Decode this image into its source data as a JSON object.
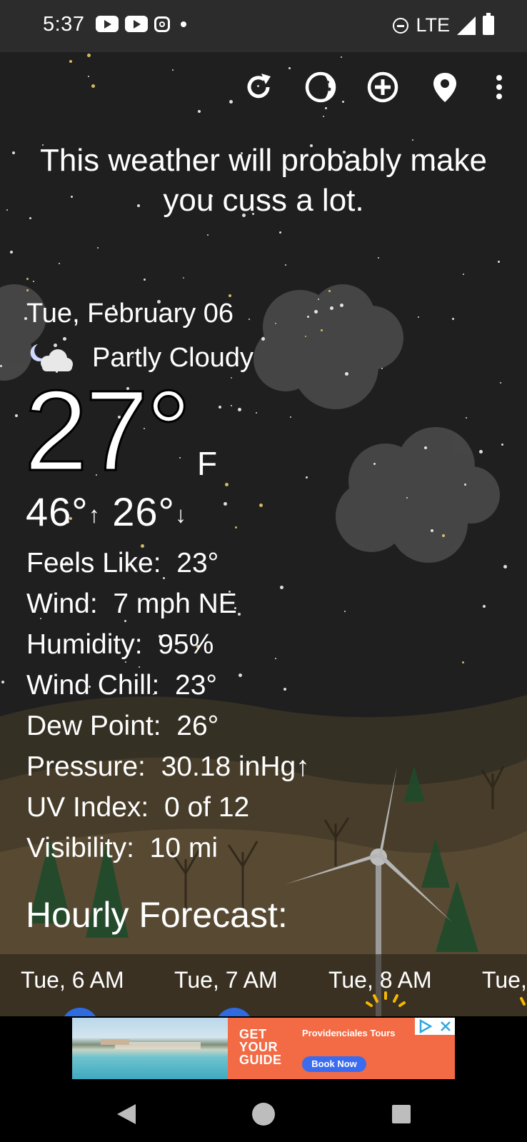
{
  "status_bar": {
    "time": "5:37",
    "network": "LTE"
  },
  "icons": {
    "refresh": "refresh-icon",
    "moon_phase": "moon-phase-icon",
    "add": "add-location-icon",
    "location": "location-pin-icon",
    "menu": "more-vert-icon"
  },
  "tagline": "This weather will probably make you cuss a lot.",
  "current": {
    "date": "Tue, February 06",
    "condition": "Partly Cloudy",
    "temperature": "27°",
    "unit": "F",
    "high": "46°",
    "low": "26°",
    "details": [
      {
        "label": "Feels Like:",
        "value": "23°"
      },
      {
        "label": "Wind:",
        "value": "7 mph NE"
      },
      {
        "label": "Humidity:",
        "value": "95%"
      },
      {
        "label": "Wind Chill:",
        "value": "23°"
      },
      {
        "label": "Dew Point:",
        "value": "26°"
      },
      {
        "label": "Pressure:",
        "value": "30.18 inHg↑"
      },
      {
        "label": "UV Index:",
        "value": "0 of 12"
      },
      {
        "label": "Visibility:",
        "value": "10 mi"
      }
    ]
  },
  "hourly": {
    "title": "Hourly Forecast:",
    "hours": [
      "Tue, 6 AM",
      "Tue, 7 AM",
      "Tue, 8 AM",
      "Tue,"
    ]
  },
  "ad": {
    "headline_1": "GET",
    "headline_2": "YOUR",
    "headline_3": "GUIDE",
    "brand": "Providenciales Tours",
    "cta": "Book Now"
  },
  "colors": {
    "background": "#1f1f20",
    "status_bar": "#2c2c2d",
    "ad_orange": "#f26b45",
    "ad_button": "#3b6cf0",
    "sun_yellow": "#f5b800"
  }
}
